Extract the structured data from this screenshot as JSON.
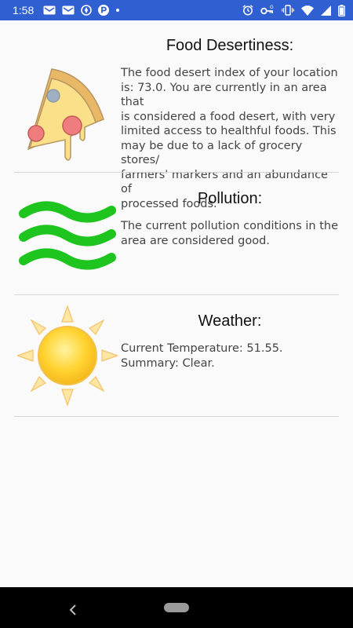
{
  "status_bar": {
    "time": "1:58",
    "left_icons": [
      "gmail-icon",
      "gmail-icon",
      "compass-icon",
      "parking-icon",
      "dot-icon"
    ],
    "right_icons": [
      "alarm-icon",
      "vpn-key-icon",
      "vibrate-icon",
      "wifi-icon",
      "signal-icon",
      "battery-icon"
    ]
  },
  "cards": [
    {
      "icon": "pizza-icon",
      "title": "Food Desertiness:",
      "body_lines": [
        "The food desert index of your location",
        "is: 73.0. You are currently in an area that",
        "is considered a food desert, with very",
        "limited access to healthful foods. This",
        "may be due to a lack of grocery stores/",
        "farmers' markers and an abundance of",
        "processed foods."
      ]
    },
    {
      "icon": "wind-waves-icon",
      "title": "Pollution:",
      "body_lines": [
        "The current pollution conditions in the",
        "area are considered good."
      ]
    },
    {
      "icon": "sun-icon",
      "title": "Weather:",
      "body_lines": [
        "Current Temperature: 51.55.",
        "Summary: Clear."
      ]
    }
  ],
  "nav_bar": {
    "back_icon": "back-icon",
    "home_icon": "home-pill-icon"
  },
  "colors": {
    "status_bar": "#2f5fd0",
    "waves": "#1ec51e",
    "pizza_crust": "#e8b866",
    "pizza_cheese": "#fbe08a",
    "pepperoni": "#f07d7d",
    "sun_core": "#ffd330",
    "sun_rays": "#ffe6a3",
    "divider": "#d6d6d6"
  }
}
